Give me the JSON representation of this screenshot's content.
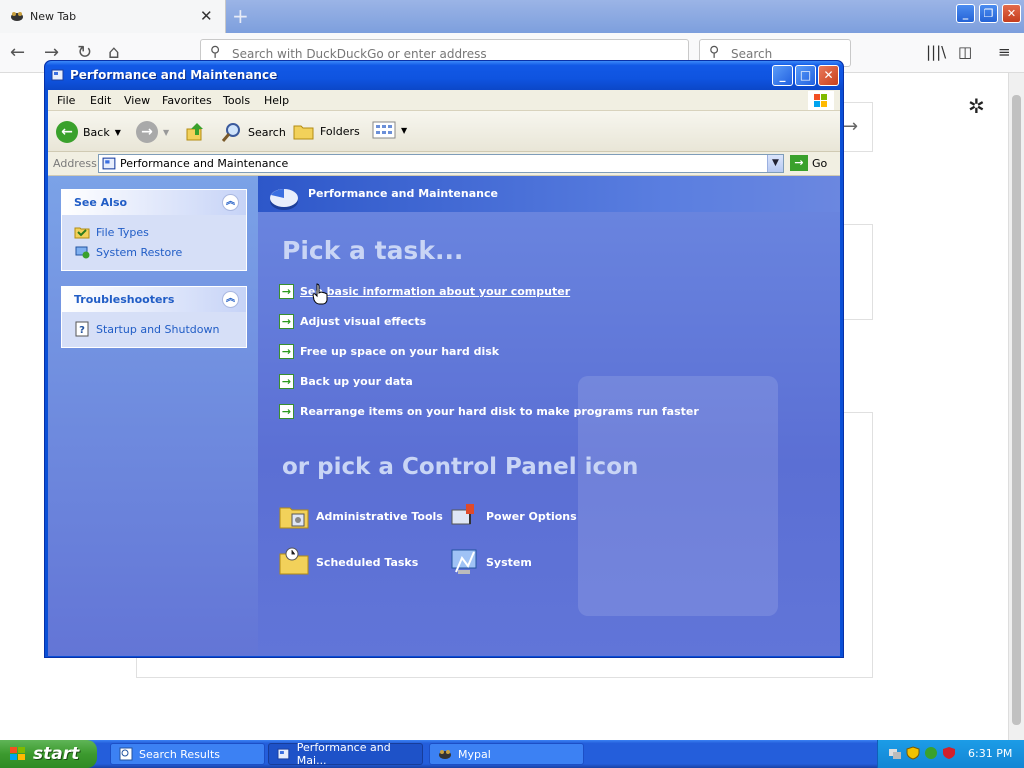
{
  "browser": {
    "tab_title": "New Tab",
    "tab_close": "✕",
    "new_tab": "+",
    "url_placeholder": "Search with DuckDuckGo or enter address",
    "search_placeholder": "Search"
  },
  "window": {
    "title": "Performance and Maintenance",
    "menu": [
      "File",
      "Edit",
      "View",
      "Favorites",
      "Tools",
      "Help"
    ],
    "toolbar": {
      "back": "Back",
      "search": "Search",
      "folders": "Folders"
    },
    "address_label": "Address",
    "address_value": "Performance and Maintenance",
    "go": "Go"
  },
  "see_also": {
    "heading": "See Also",
    "items": [
      "File Types",
      "System Restore"
    ]
  },
  "troubleshooters": {
    "heading": "Troubleshooters",
    "items": [
      "Startup and Shutdown"
    ]
  },
  "main": {
    "header": "Performance and Maintenance",
    "pick_task": "Pick a task...",
    "tasks": [
      "See basic information about your computer",
      "Adjust visual effects",
      "Free up space on your hard disk",
      "Back up your data",
      "Rearrange items on your hard disk to make programs run faster"
    ],
    "pick_icon": "or pick a Control Panel icon",
    "icons": [
      "Administrative Tools",
      "Power Options",
      "Scheduled Tasks",
      "System"
    ]
  },
  "taskbar": {
    "start": "start",
    "buttons": [
      "Search Results",
      "Performance and Mai...",
      "Mypal"
    ],
    "clock": "6:31 PM"
  },
  "colors": {
    "xp_blue": "#0a4fd6",
    "pane_blue": "#6b87e0",
    "link_blue": "#215dc6",
    "start_green": "#3c9a2e"
  }
}
